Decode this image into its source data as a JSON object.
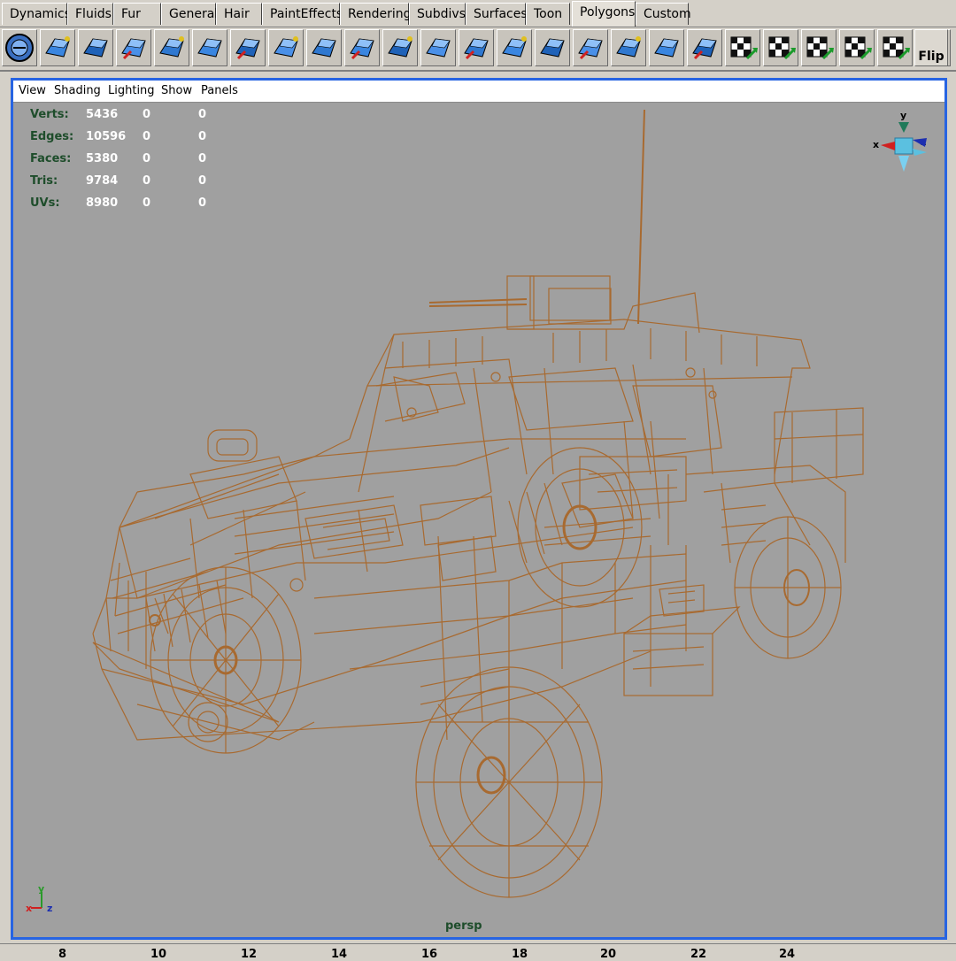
{
  "shelf_tabs": [
    "Dynamics",
    "Fluids",
    "Fur",
    "General",
    "Hair",
    "PaintEffects",
    "Rendering",
    "Subdivs",
    "Surfaces",
    "Toon",
    "Polygons",
    "Custom"
  ],
  "active_shelf": "Polygons",
  "tools": [
    "sphere-icon",
    "combine-icon",
    "separate-icon",
    "extract-icon",
    "cube-icon",
    "smooth-proxy-icon",
    "triangulate-icon",
    "quadrangulate-icon",
    "bevel-icon",
    "extrude-face-icon",
    "poke-face-icon",
    "wedge-face-icon",
    "split-polygon-icon",
    "extrude-edge-icon",
    "subdivide-icon",
    "cut-faces-icon",
    "append-polygon-icon",
    "duplicate-face-icon",
    "merge-vertices-icon",
    "create-uvs-icon",
    "planar-map-icon",
    "cylindrical-map-icon",
    "automatic-map-icon",
    "spherical-map-icon",
    "uv-texture-editor-icon"
  ],
  "flip_button": "Flip",
  "panel_menu": [
    "View",
    "Shading",
    "Lighting",
    "Show",
    "Panels"
  ],
  "hud_stats": [
    {
      "label": "Verts:",
      "values": [
        "5436",
        "0",
        "0"
      ]
    },
    {
      "label": "Edges:",
      "values": [
        "10596",
        "0",
        "0"
      ]
    },
    {
      "label": "Faces:",
      "values": [
        "5380",
        "0",
        "0"
      ]
    },
    {
      "label": "Tris:",
      "values": [
        "9784",
        "0",
        "0"
      ]
    },
    {
      "label": "UVs:",
      "values": [
        "8980",
        "0",
        "0"
      ]
    }
  ],
  "view_cube_axes": [
    "y",
    "x",
    "z"
  ],
  "origin_axes": [
    "y",
    "x",
    "z"
  ],
  "camera_name": "persp",
  "timeline_ticks": [
    "8",
    "10",
    "12",
    "14",
    "16",
    "18",
    "20",
    "22",
    "24"
  ],
  "colors": {
    "wireframe": "#a86a30",
    "viewport_bg": "#a0a0a0",
    "panel_border": "#2764e2",
    "hud_label": "#1e4d2b",
    "hud_value": "#ffffff"
  }
}
